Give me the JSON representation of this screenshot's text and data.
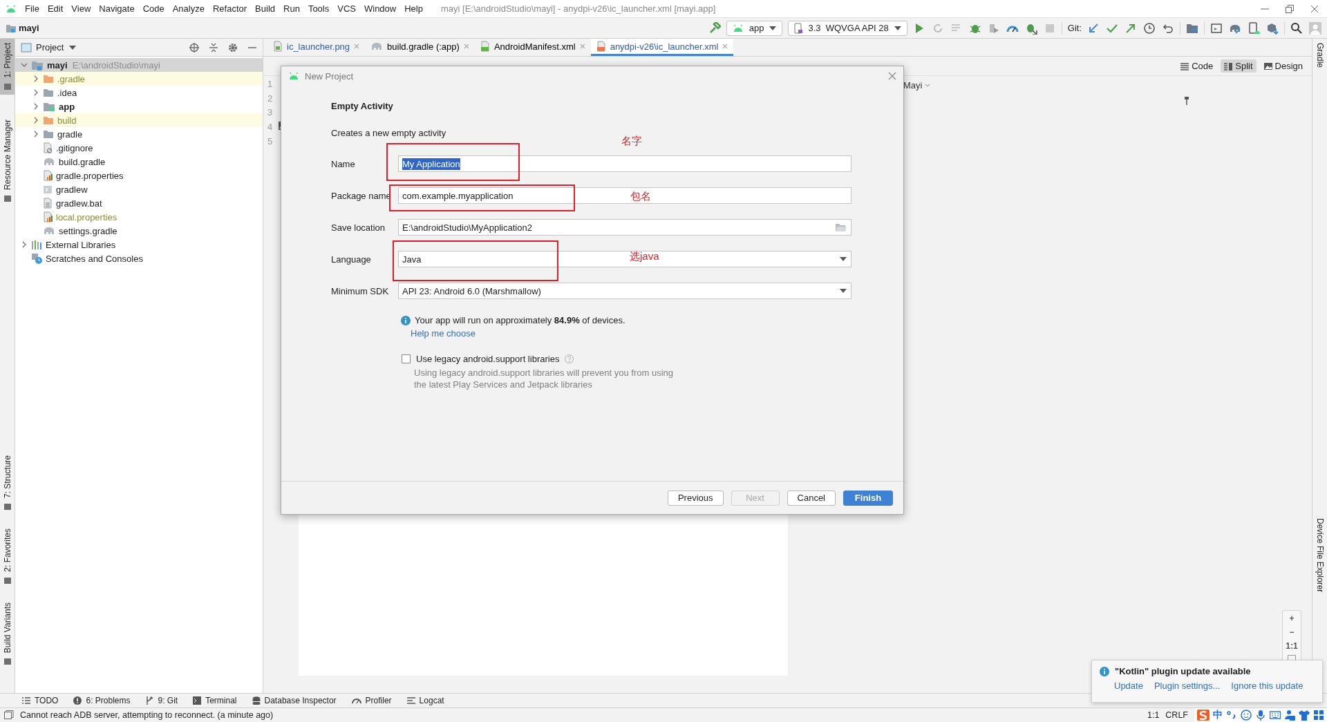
{
  "window": {
    "title": "mayi [E:\\androidStudio\\mayi] - anydpi-v26\\ic_launcher.xml [mayi.app]",
    "menu": [
      "File",
      "Edit",
      "View",
      "Navigate",
      "Code",
      "Analyze",
      "Refactor",
      "Build",
      "Run",
      "Tools",
      "VCS",
      "Window",
      "Help"
    ]
  },
  "navbar": {
    "project": "mayi",
    "run_config": "app",
    "device": "3.3  WQVGA API 28",
    "git_label": "Git:"
  },
  "left_stripe": {
    "top": [
      {
        "label": "1: Project",
        "selected": true
      },
      {
        "label": "Resource Manager",
        "selected": false
      }
    ],
    "bottom": [
      {
        "label": "7: Structure",
        "selected": false
      },
      {
        "label": "2: Favorites",
        "selected": false
      },
      {
        "label": "Build Variants",
        "selected": false
      }
    ]
  },
  "project_panel": {
    "title": "Project",
    "tree": [
      {
        "name": "mayi",
        "path": "E:\\androidStudio\\mayi",
        "kind": "project",
        "expanded": true,
        "selected": true,
        "ignored": false,
        "children": [
          {
            "name": ".gradle",
            "kind": "excluded-folder",
            "expanded": false,
            "selected": false,
            "ignored": true
          },
          {
            "name": ".idea",
            "kind": "folder",
            "expanded": false,
            "selected": false,
            "ignored": false
          },
          {
            "name": "app",
            "kind": "module",
            "expanded": false,
            "selected": false,
            "ignored": false
          },
          {
            "name": "build",
            "kind": "excluded-folder",
            "expanded": false,
            "selected": false,
            "ignored": true
          },
          {
            "name": "gradle",
            "kind": "folder",
            "expanded": false,
            "selected": false,
            "ignored": false
          },
          {
            "name": ".gitignore",
            "kind": "ignore-file",
            "selected": false,
            "ignored": false
          },
          {
            "name": "build.gradle",
            "kind": "gradle-file",
            "selected": false,
            "ignored": false
          },
          {
            "name": "gradle.properties",
            "kind": "properties-file",
            "selected": false,
            "ignored": false
          },
          {
            "name": "gradlew",
            "kind": "script-file",
            "selected": false,
            "ignored": false
          },
          {
            "name": "gradlew.bat",
            "kind": "text-file",
            "selected": false,
            "ignored": false
          },
          {
            "name": "local.properties",
            "kind": "properties-file",
            "selected": false,
            "ignored": true
          },
          {
            "name": "settings.gradle",
            "kind": "gradle-file",
            "selected": false,
            "ignored": false
          }
        ]
      },
      {
        "name": "External Libraries",
        "kind": "libraries",
        "expanded": false,
        "selected": false,
        "ignored": false
      },
      {
        "name": "Scratches and Consoles",
        "kind": "scratches",
        "selected": false,
        "ignored": false
      }
    ]
  },
  "editor": {
    "tabs": [
      {
        "label": "ic_launcher.png",
        "kind": "image",
        "selected": false,
        "color": "#2a5db0"
      },
      {
        "label": "build.gradle (:app)",
        "kind": "gradle",
        "selected": false,
        "color": "#000000"
      },
      {
        "label": "AndroidManifest.xml",
        "kind": "manifest",
        "selected": false,
        "color": "#000000"
      },
      {
        "label": "anydpi-v26\\ic_launcher.xml",
        "kind": "xml",
        "selected": true,
        "color": "#2a5db0"
      }
    ],
    "line_numbers": [
      "1",
      "2",
      "3",
      "4",
      "5"
    ],
    "view_modes": [
      {
        "label": "Code",
        "kind": "code",
        "selected": false
      },
      {
        "label": "Split",
        "kind": "split",
        "selected": true
      },
      {
        "label": "Design",
        "kind": "design",
        "selected": false
      }
    ],
    "preview_title": "Mayi",
    "zoom_controls": [
      "+",
      "−",
      "1:1"
    ]
  },
  "dialog": {
    "title": "New Project",
    "heading": "Empty Activity",
    "description": "Creates a new empty activity",
    "fields": [
      {
        "label": "Name",
        "kind": "text",
        "value": "My Application",
        "selected": true,
        "annotation": "名字"
      },
      {
        "label": "Package name",
        "kind": "text",
        "value": "com.example.myapplication",
        "selected": false,
        "annotation": "包名"
      },
      {
        "label": "Save location",
        "kind": "path",
        "value": "E:\\androidStudio\\MyApplication2",
        "selected": false
      },
      {
        "label": "Language",
        "kind": "dropdown",
        "value": "Java",
        "selected": false,
        "annotation": "选java"
      },
      {
        "label": "Minimum SDK",
        "kind": "dropdown",
        "value": "API 23: Android 6.0 (Marshmallow)",
        "selected": false
      }
    ],
    "info": "Your app will run on approximately **84.9%** of devices.",
    "help_link": "Help me choose",
    "legacy": {
      "label": "Use legacy android.support libraries",
      "checked": false,
      "note": [
        "Using legacy android.support libraries will prevent you from using",
        "the latest Play Services and Jetpack libraries"
      ]
    },
    "buttons": [
      {
        "label": "Previous",
        "disabled": false,
        "default": false
      },
      {
        "label": "Next",
        "disabled": true,
        "default": false
      },
      {
        "label": "Cancel",
        "disabled": false,
        "default": false
      },
      {
        "label": "Finish",
        "disabled": false,
        "default": true
      }
    ]
  },
  "right_stripe": {
    "top": [
      {
        "label": "Gradle"
      }
    ],
    "bottom": [
      {
        "label": "Device File Explorer"
      }
    ]
  },
  "bottom_tools": [
    {
      "label": "TODO",
      "kind": "todo"
    },
    {
      "label": "6: Problems",
      "kind": "problems"
    },
    {
      "label": "9: Git",
      "kind": "git"
    },
    {
      "label": "Terminal",
      "kind": "terminal"
    },
    {
      "label": "Database Inspector",
      "kind": "database"
    },
    {
      "label": "Profiler",
      "kind": "profiler"
    },
    {
      "label": "Logcat",
      "kind": "logcat"
    }
  ],
  "notification": {
    "title": "\"Kotlin\" plugin update available",
    "actions": [
      "Update",
      "Plugin settings...",
      "Ignore this update"
    ]
  },
  "status_bar": {
    "message": "Cannot reach ADB server, attempting to reconnect. (a minute ago)",
    "position": "1:1",
    "line_separator": "CRLF",
    "ime_mode": "中"
  }
}
